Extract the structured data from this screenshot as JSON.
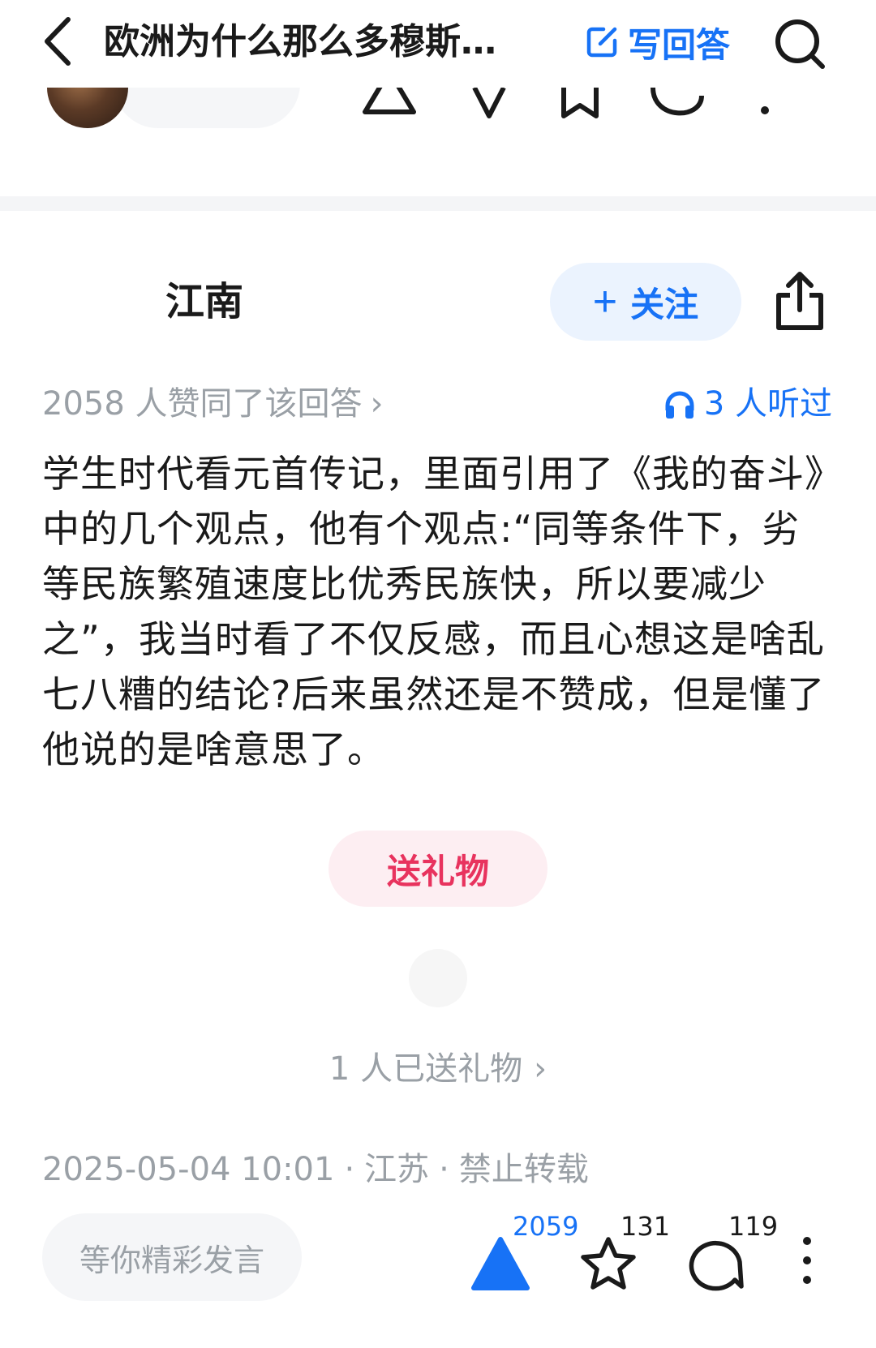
{
  "nav": {
    "title": "欧洲为什么那么多穆斯…",
    "write_answer_label": "写回答"
  },
  "author": {
    "name": "江南",
    "follow_label": "关注"
  },
  "stats": {
    "agree_text": "2058 人赞同了该回答",
    "listened_text": "3 人听过"
  },
  "answer": {
    "text": "学生时代看元首传记，里面引用了《我的奋斗》中的几个观点，他有个观点:“同等条件下，劣等民族繁殖速度比优秀民族快，所以要减少之”，我当时看了不仅反感，而且心想这是啥乱七八糟的结论?后来虽然还是不赞成，但是懂了他说的是啥意思了。"
  },
  "gift": {
    "button_label": "送礼物",
    "count_text": "1 人已送礼物"
  },
  "meta": {
    "datetime": "2025-05-04 10:01",
    "location": "江苏",
    "copyright": "禁止转载"
  },
  "bottom_bar": {
    "comment_placeholder": "等你精彩发言",
    "upvote_count": "2059",
    "favorite_count": "131",
    "comment_count": "119"
  },
  "colors": {
    "accent": "#1772f6",
    "gift": "#e8335e",
    "muted": "#9aa0a6"
  },
  "icons": [
    "back-icon",
    "edit-icon",
    "search-icon",
    "share-icon",
    "headphones-icon",
    "upvote-icon",
    "star-icon",
    "comment-icon",
    "more-icon"
  ]
}
